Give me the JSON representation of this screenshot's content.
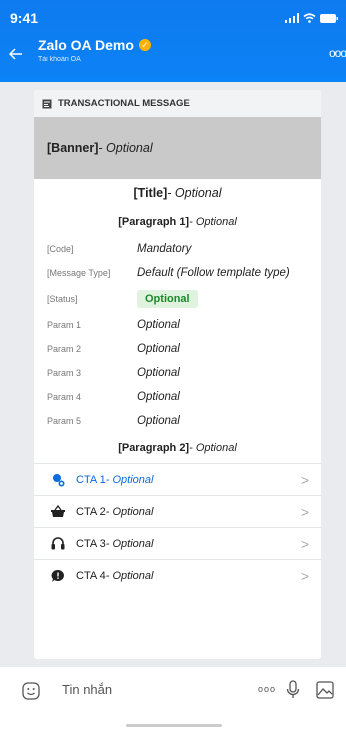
{
  "status_bar": {
    "time": "9:41"
  },
  "header": {
    "title": "Zalo OA Demo",
    "subtitle": "Tài khoản OA"
  },
  "card": {
    "label": "TRANSACTIONAL MESSAGE",
    "banner": {
      "bold": "[Banner]",
      "rest": " - Optional"
    },
    "title": {
      "bold": "[Title]",
      "rest": " - Optional"
    },
    "paragraph1": {
      "bold": "[Paragraph 1]",
      "rest": " - Optional"
    },
    "fields": [
      {
        "label": "[Code]",
        "value": "Mandatory"
      },
      {
        "label": "[Message Type]",
        "value": "Default (Follow template type)"
      },
      {
        "label": "[Status]",
        "value": "Optional"
      },
      {
        "label": "Param 1",
        "value": "Optional"
      },
      {
        "label": "Param 2",
        "value": "Optional"
      },
      {
        "label": "Param 3",
        "value": "Optional"
      },
      {
        "label": "Param 4",
        "value": "Optional"
      },
      {
        "label": "Param 5",
        "value": "Optional"
      }
    ],
    "paragraph2": {
      "bold": "[Paragraph 2]",
      "rest": " - Optional"
    },
    "ctas": [
      {
        "name": "CTA 1",
        "rest": " - Optional",
        "icon": "user-support-icon"
      },
      {
        "name": "CTA 2",
        "rest": " - Optional",
        "icon": "shopping-basket-icon"
      },
      {
        "name": "CTA 3",
        "rest": " - Optional",
        "icon": "headphones-icon"
      },
      {
        "name": "CTA 4",
        "rest": " - Optional",
        "icon": "chat-bubble-icon"
      }
    ]
  },
  "input_bar": {
    "placeholder": "Tin nhắn",
    "more": "ooo"
  },
  "colors": {
    "header": "#0b82f5",
    "cta_active": "#0a6ae0",
    "status_chip_bg": "#dff3df",
    "status_chip_text": "#1a8a2a",
    "banner_bg": "#c9c9c9"
  }
}
